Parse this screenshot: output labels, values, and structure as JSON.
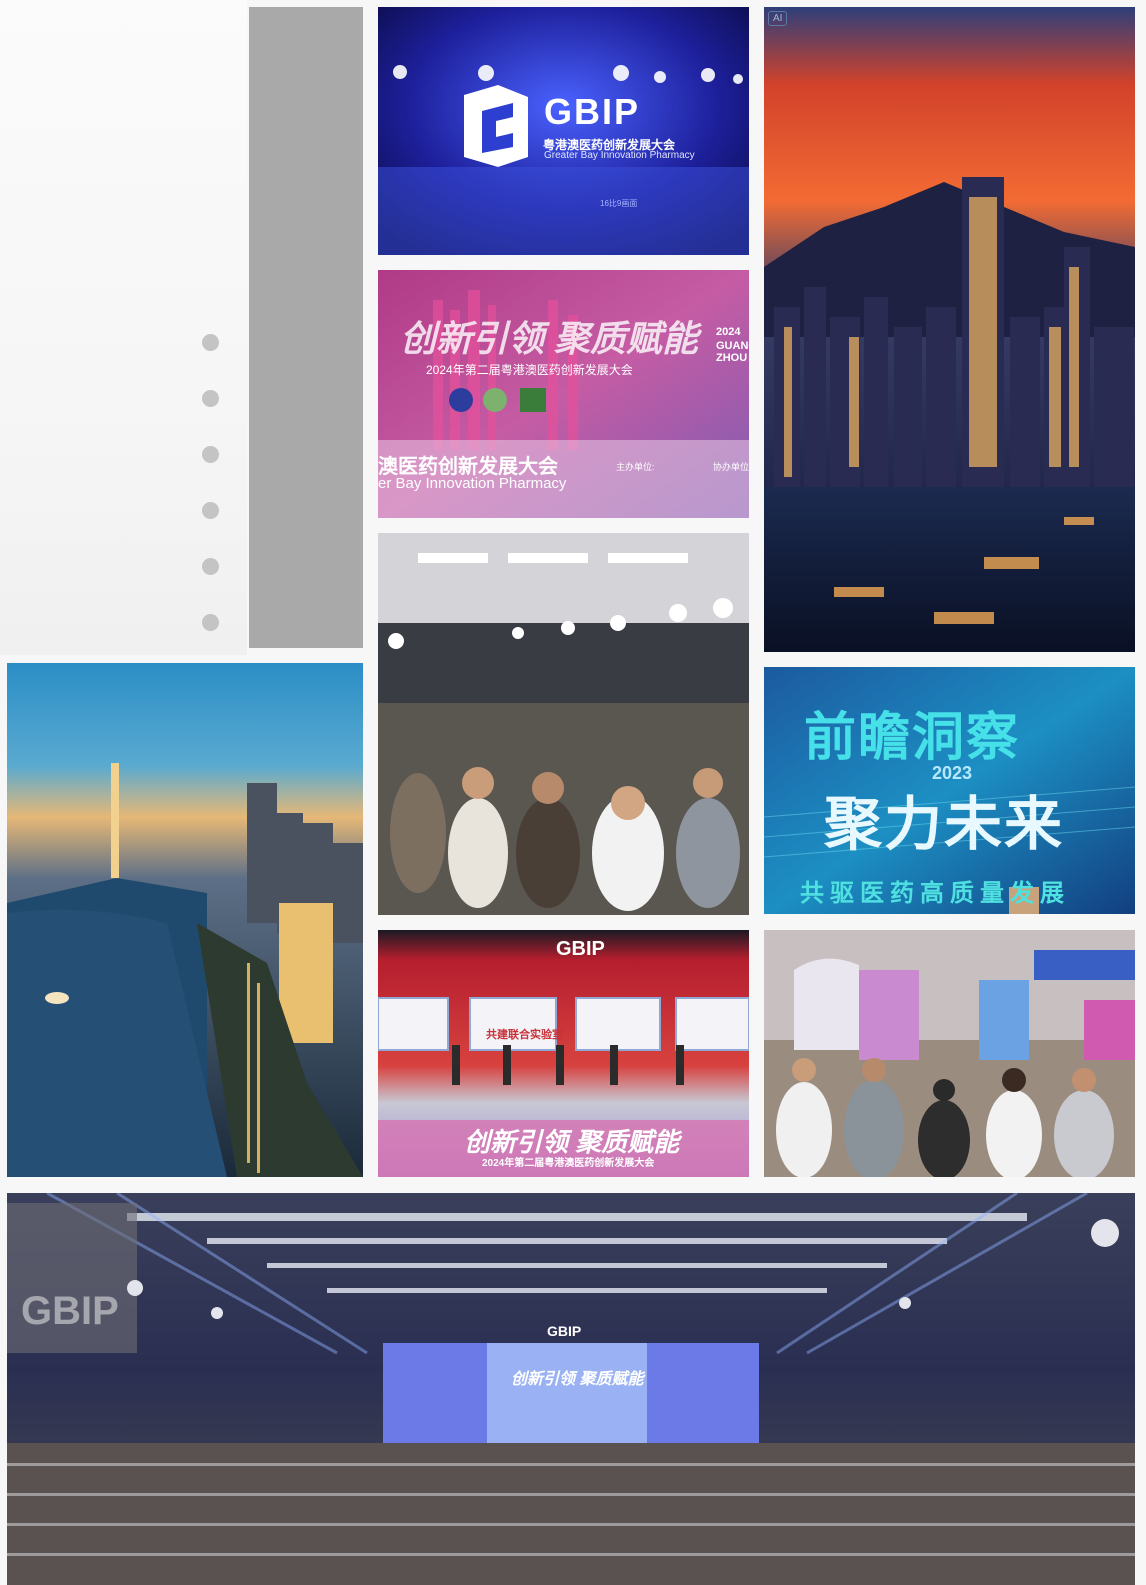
{
  "gallery": {
    "dots_count": 6,
    "ai_badge": "AI",
    "stage_photo": {
      "logo": "GBIP",
      "subtitle_cn": "粤港澳医药创新发展大会",
      "subtitle_en": "Greater Bay Innovation Pharmacy",
      "caption": "16比9画面"
    },
    "banner_photo": {
      "headline": "创新引领 聚质赋能",
      "sub": "2024年第二届粤港澳医药创新发展大会",
      "name_cn": "澳医药创新发展大会",
      "name_en": "er Bay Innovation Pharmacy",
      "organizer": "主办单位:",
      "co_organizer": "协办单位",
      "year": "2024",
      "city": "GUANG ZHOU"
    },
    "teal_photo": {
      "line1": "前瞻洞察",
      "line2": "聚力未来",
      "year": "2023",
      "bottom": "共驱医药高质量发展"
    },
    "ceremony_photo": {
      "logo": "GBIP",
      "headline": "创新引领 聚质赋能",
      "sub": "2024年第二届粤港澳医药创新发展大会",
      "plaque": "共建联合实验室"
    },
    "hall_photo": {
      "logo_left": "GBIP",
      "logo_center": "GBIP",
      "screen": "创新引领 聚质赋能"
    }
  }
}
